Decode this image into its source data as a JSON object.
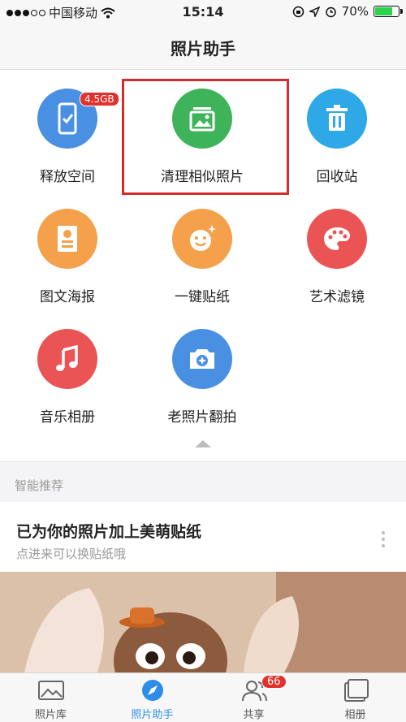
{
  "status_bar": {
    "carrier": "中国移动",
    "time": "15:14",
    "battery_percent": "70%",
    "battery_level": 0.7,
    "battery_color": "#2bd34b"
  },
  "nav": {
    "title": "照片助手"
  },
  "tools": [
    {
      "label": "释放空间",
      "icon": "phone-check-icon",
      "color": "#4a90e2",
      "badge": "4.5GB"
    },
    {
      "label": "清理相似照片",
      "icon": "photo-stack-icon",
      "color": "#3fb35a",
      "highlighted": true
    },
    {
      "label": "回收站",
      "icon": "trash-icon",
      "color": "#2fa8e8"
    },
    {
      "label": "图文海报",
      "icon": "poster-icon",
      "color": "#f5a04a"
    },
    {
      "label": "一键贴纸",
      "icon": "smiley-sticker-icon",
      "color": "#f5a04a"
    },
    {
      "label": "艺术滤镜",
      "icon": "palette-icon",
      "color": "#ea5455"
    },
    {
      "label": "音乐相册",
      "icon": "music-note-icon",
      "color": "#ea5455"
    },
    {
      "label": "老照片翻拍",
      "icon": "camera-icon",
      "color": "#4a90e2"
    }
  ],
  "recommend": {
    "section_title": "智能推荐",
    "card_title": "已为你的照片加上美萌贴纸",
    "card_subtitle": "点进来可以换贴纸哦"
  },
  "tab_bar": {
    "tabs": [
      {
        "label": "照片库",
        "icon": "photo-library-icon"
      },
      {
        "label": "照片助手",
        "icon": "compass-icon",
        "active": true
      },
      {
        "label": "共享",
        "icon": "people-icon",
        "badge": "66"
      },
      {
        "label": "相册",
        "icon": "album-icon"
      }
    ]
  }
}
